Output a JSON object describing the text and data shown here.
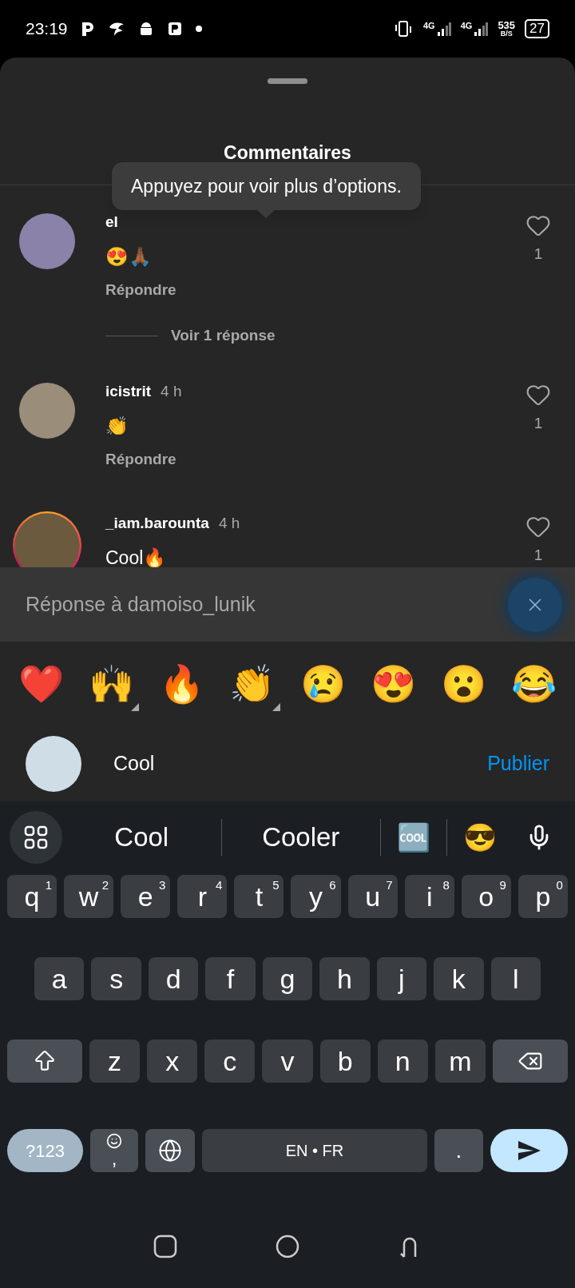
{
  "status_bar": {
    "time": "23:19",
    "network_1": "4G",
    "network_2": "4G",
    "speed": "535",
    "speed_unit": "B/S",
    "battery": "27"
  },
  "sheet": {
    "title": "Commentaires",
    "tooltip": "Appuyez pour voir plus d’options.",
    "comments": [
      {
        "username": "el",
        "text": "😍🙏🏾",
        "reply_label": "Répondre",
        "likes": "1",
        "view_replies": "Voir 1 réponse",
        "has_story": false
      },
      {
        "username": "icistrit",
        "time": "4 h",
        "text": "👏",
        "reply_label": "Répondre",
        "likes": "1",
        "has_story": false
      },
      {
        "username": "_iam.barounta",
        "time": "4 h",
        "text": "Cool🔥",
        "likes": "1",
        "has_story": true
      }
    ],
    "reply_banner": {
      "text": "Réponse à damoiso_lunik"
    },
    "reactions": [
      {
        "emoji": "❤️",
        "has_variants": false
      },
      {
        "emoji": "🙌",
        "has_variants": true
      },
      {
        "emoji": "🔥",
        "has_variants": false
      },
      {
        "emoji": "👏",
        "has_variants": true
      },
      {
        "emoji": "😢",
        "has_variants": false
      },
      {
        "emoji": "😍",
        "has_variants": false
      },
      {
        "emoji": "😮",
        "has_variants": false
      },
      {
        "emoji": "😂",
        "has_variants": false
      }
    ],
    "composer": {
      "value": "Cool",
      "publish": "Publier"
    }
  },
  "keyboard": {
    "suggestions": [
      {
        "kind": "word",
        "text": "Cool"
      },
      {
        "kind": "word",
        "text": "Cooler"
      },
      {
        "kind": "emoji",
        "text": "🆒"
      },
      {
        "kind": "emoji",
        "text": "😎"
      }
    ],
    "rows": [
      {
        "keys": [
          {
            "kind": "letter",
            "label": "q",
            "hint": "1"
          },
          {
            "kind": "letter",
            "label": "w",
            "hint": "2"
          },
          {
            "kind": "letter",
            "label": "e",
            "hint": "3"
          },
          {
            "kind": "letter",
            "label": "r",
            "hint": "4"
          },
          {
            "kind": "letter",
            "label": "t",
            "hint": "5"
          },
          {
            "kind": "letter",
            "label": "y",
            "hint": "6"
          },
          {
            "kind": "letter",
            "label": "u",
            "hint": "7"
          },
          {
            "kind": "letter",
            "label": "i",
            "hint": "8"
          },
          {
            "kind": "letter",
            "label": "o",
            "hint": "9"
          },
          {
            "kind": "letter",
            "label": "p",
            "hint": "0"
          }
        ]
      },
      {
        "keys": [
          {
            "kind": "letter",
            "label": "a"
          },
          {
            "kind": "letter",
            "label": "s"
          },
          {
            "kind": "letter",
            "label": "d"
          },
          {
            "kind": "letter",
            "label": "f"
          },
          {
            "kind": "letter",
            "label": "g"
          },
          {
            "kind": "letter",
            "label": "h"
          },
          {
            "kind": "letter",
            "label": "j"
          },
          {
            "kind": "letter",
            "label": "k"
          },
          {
            "kind": "letter",
            "label": "l"
          }
        ]
      },
      {
        "keys": [
          {
            "kind": "shift"
          },
          {
            "kind": "letter",
            "label": "z"
          },
          {
            "kind": "letter",
            "label": "x"
          },
          {
            "kind": "letter",
            "label": "c"
          },
          {
            "kind": "letter",
            "label": "v"
          },
          {
            "kind": "letter",
            "label": "b"
          },
          {
            "kind": "letter",
            "label": "n"
          },
          {
            "kind": "letter",
            "label": "m"
          },
          {
            "kind": "backspace"
          }
        ]
      },
      {
        "keys": [
          {
            "kind": "symbols",
            "label": "?123"
          },
          {
            "kind": "comma",
            "label": ","
          },
          {
            "kind": "globe"
          },
          {
            "kind": "space",
            "label": "EN • FR"
          },
          {
            "kind": "period",
            "label": "."
          },
          {
            "kind": "send"
          }
        ]
      }
    ]
  }
}
